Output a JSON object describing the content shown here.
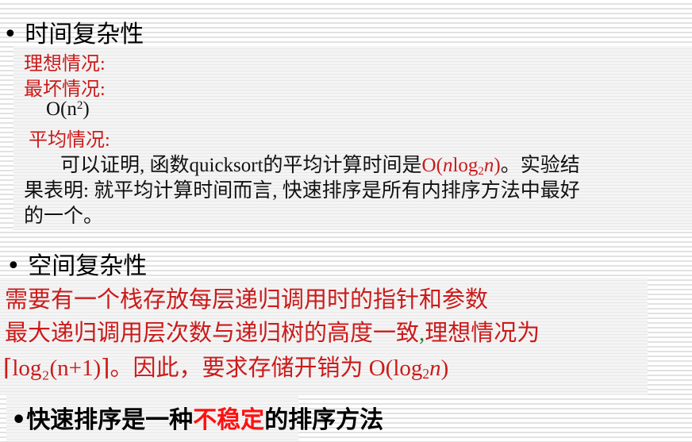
{
  "time_complexity": {
    "heading": "时间复杂性",
    "best_label": "理想情况:",
    "worst_label": "最坏情况:",
    "worst_value": "O(n²)",
    "average_label": "平均情况:",
    "average_text_1": "可以证明, 函数quicksort的平均计算时间是",
    "average_value": "O(nlog₂n)",
    "average_text_2": "。实验结",
    "average_text_3": "果表明: 就平均计算时间而言, 快速排序是所有内排序方法中最好",
    "average_text_4": "的一个。"
  },
  "space_complexity": {
    "heading": "空间复杂性",
    "line_1": "需要有一个栈存放每层递归调用时的指针和参数",
    "line_2a": "最大递归调用层次数与递归树的高度一致",
    "line_2_comma": ",",
    "line_2b": "理想情况为",
    "line_3a": "⌈log₂(n+1)⌉",
    "line_3b": "。因此，要求存储开销为 O(log₂n)"
  },
  "stability": {
    "text_1": "快速排序是一种",
    "highlight": "不稳定",
    "text_2": "的排序方法"
  },
  "colors": {
    "accent_red": "#cc1a1a",
    "highlight_red": "#ff1010"
  }
}
